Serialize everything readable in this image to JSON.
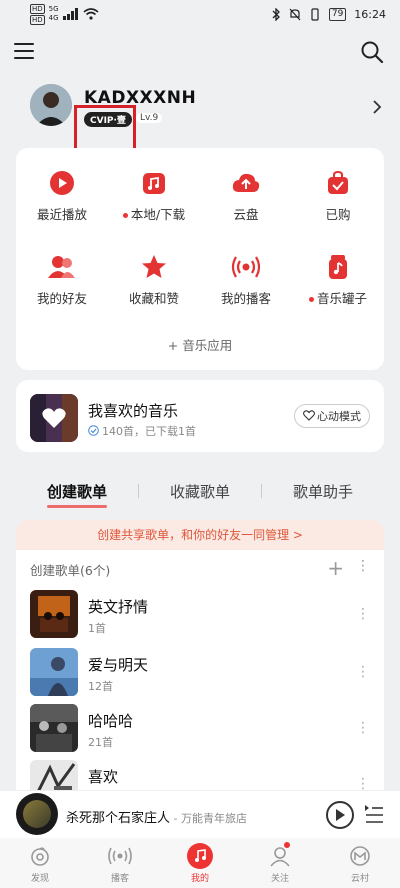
{
  "status": {
    "time": "16:24",
    "battery": "79",
    "net1": "HD",
    "net2": "HD",
    "sig1": "5G",
    "sig2": "4G"
  },
  "profile": {
    "username": "KADXXXNH",
    "vip": "CVIP·壹",
    "level": "Lv.9"
  },
  "grid": [
    {
      "label": "最近播放",
      "icon": "play-circle-icon",
      "dot": false
    },
    {
      "label": "本地/下载",
      "icon": "local-music-icon",
      "dot": true
    },
    {
      "label": "云盘",
      "icon": "cloud-upload-icon",
      "dot": false
    },
    {
      "label": "已购",
      "icon": "purchased-bag-icon",
      "dot": false
    },
    {
      "label": "我的好友",
      "icon": "friends-icon",
      "dot": false
    },
    {
      "label": "收藏和赞",
      "icon": "star-icon",
      "dot": false
    },
    {
      "label": "我的播客",
      "icon": "podcast-icon",
      "dot": false
    },
    {
      "label": "音乐罐子",
      "icon": "music-jar-icon",
      "dot": true
    }
  ],
  "music_apps": "+ 音乐应用",
  "favorite": {
    "title": "我喜欢的音乐",
    "sub": "140首，已下载1首",
    "mode": "心动模式"
  },
  "tabs": [
    "创建歌单",
    "收藏歌单",
    "歌单助手"
  ],
  "share_bar": "创建共享歌单，和你的好友一同管理 >",
  "playlists": {
    "header": "创建歌单(6个)",
    "add": "+",
    "more": "⋮",
    "items": [
      {
        "name": "英文抒情",
        "count": "1首"
      },
      {
        "name": "爱与明天",
        "count": "12首"
      },
      {
        "name": "哈哈哈",
        "count": "21首"
      },
      {
        "name": "喜欢",
        "count": ""
      }
    ]
  },
  "player": {
    "song": "杀死那个石家庄人",
    "artist": "万能青年旅店",
    "sep": " - "
  },
  "nav": [
    {
      "label": "发现",
      "icon": "discover-icon"
    },
    {
      "label": "播客",
      "icon": "podcast-nav-icon"
    },
    {
      "label": "我的",
      "icon": "my-music-icon"
    },
    {
      "label": "关注",
      "icon": "follow-icon"
    },
    {
      "label": "云村",
      "icon": "cloud-village-icon"
    }
  ],
  "colors": {
    "accent": "#e33333",
    "background": "#eef0f2"
  }
}
